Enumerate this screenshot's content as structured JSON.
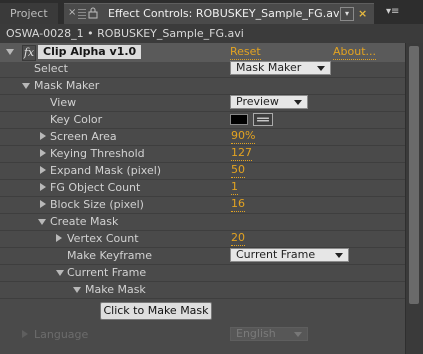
{
  "tabs": {
    "project_label": "Project",
    "active_label": "Effect Controls: ROBUSKEY_Sample_FG.avi",
    "close_symbol": "×",
    "dropdown_symbol": "▾",
    "menu_symbol": "▾≡"
  },
  "subheader": {
    "text": "OSWA-0028_1 • ROBUSKEY_Sample_FG.avi"
  },
  "effect": {
    "fx_badge": "fx",
    "name": "Clip Alpha v1.0",
    "reset": "Reset",
    "about": "About..."
  },
  "rows": {
    "select_label": "Select",
    "select_value": "Mask Maker",
    "mask_maker": "Mask Maker",
    "view_label": "View",
    "view_value": "Preview",
    "key_color_label": "Key Color",
    "screen_area_label": "Screen Area",
    "screen_area_value": "90%",
    "keying_threshold_label": "Keying Threshold",
    "keying_threshold_value": "127",
    "expand_mask_label": "Expand Mask (pixel)",
    "expand_mask_value": "50",
    "fg_object_count_label": "FG Object Count",
    "fg_object_count_value": "1",
    "block_size_label": "Block Size (pixel)",
    "block_size_value": "16",
    "create_mask_label": "Create Mask",
    "vertex_count_label": "Vertex Count",
    "vertex_count_value": "20",
    "make_keyframe_label": "Make Keyframe",
    "make_keyframe_value": "Current Frame",
    "current_frame_label": "Current Frame",
    "make_mask_label": "Make Mask",
    "make_mask_button": "Click to Make Mask",
    "language_label": "Language",
    "language_value": "English"
  },
  "colors": {
    "accent": "#e3a321",
    "panel_bg": "#4a4a4a",
    "key_color": "#000000"
  }
}
